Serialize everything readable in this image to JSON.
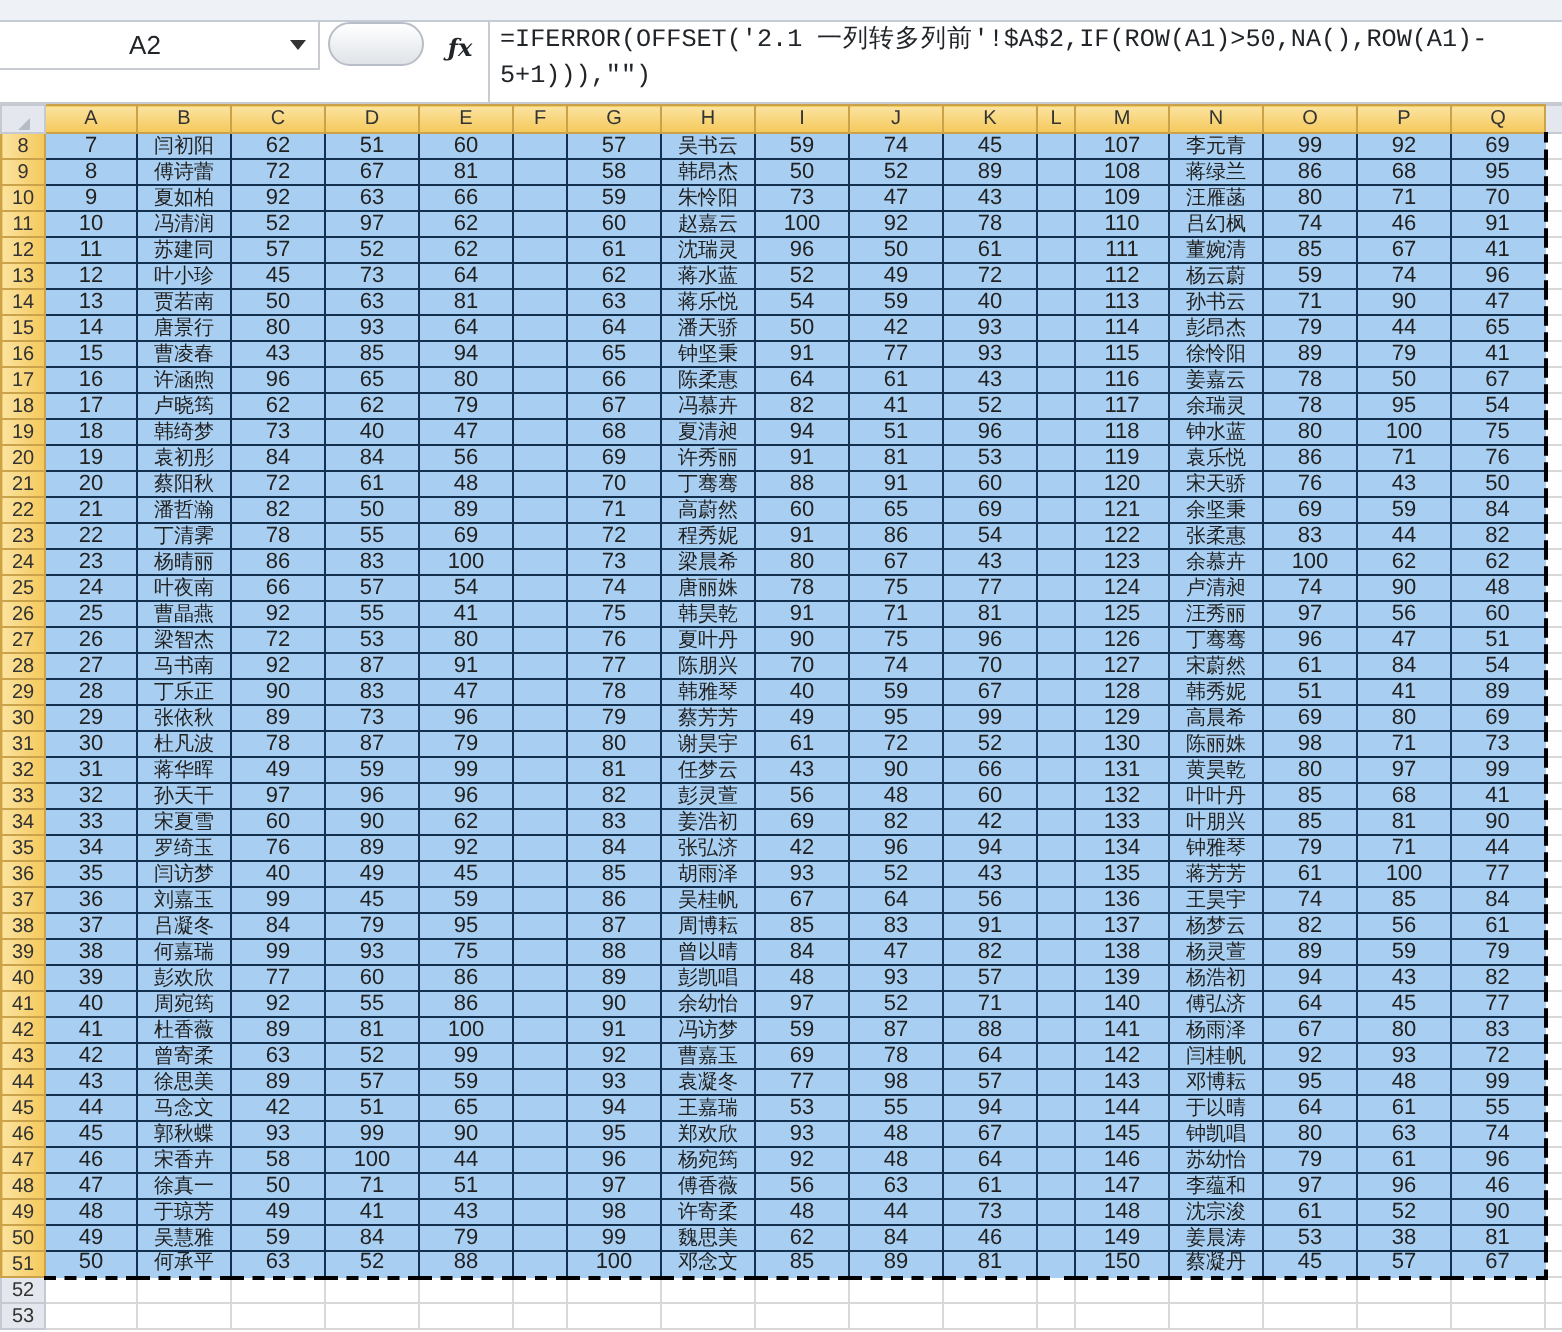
{
  "formula_bar": {
    "name_box": "A2",
    "function_symbol": "ƒx",
    "formula_lines": [
      "=IFERROR(OFFSET('2.1 一列转多列前'!$A$2,IF(ROW(A1)>50,NA(),ROW(A1)-",
      "5+1))),\"\")"
    ]
  },
  "columns": [
    {
      "letter": "A",
      "kind": "data",
      "selected": true
    },
    {
      "letter": "B",
      "kind": "data",
      "selected": true
    },
    {
      "letter": "C",
      "kind": "data",
      "selected": true
    },
    {
      "letter": "D",
      "kind": "data",
      "selected": true
    },
    {
      "letter": "E",
      "kind": "data",
      "selected": true
    },
    {
      "letter": "F",
      "kind": "spacer",
      "selected": true
    },
    {
      "letter": "G",
      "kind": "data",
      "selected": true
    },
    {
      "letter": "H",
      "kind": "data",
      "selected": true
    },
    {
      "letter": "I",
      "kind": "data",
      "selected": true
    },
    {
      "letter": "J",
      "kind": "data",
      "selected": true
    },
    {
      "letter": "K",
      "kind": "data",
      "selected": true
    },
    {
      "letter": "L",
      "kind": "spacer",
      "selected": true
    },
    {
      "letter": "M",
      "kind": "data",
      "selected": true
    },
    {
      "letter": "N",
      "kind": "data",
      "selected": true
    },
    {
      "letter": "O",
      "kind": "data",
      "selected": true
    },
    {
      "letter": "P",
      "kind": "data",
      "selected": true
    },
    {
      "letter": "Q",
      "kind": "data",
      "selected": true
    }
  ],
  "rows": [
    {
      "number": "8",
      "selected": true,
      "cells": [
        "7",
        "闫初阳",
        "62",
        "51",
        "60",
        "57",
        "吴书云",
        "59",
        "74",
        "45",
        "107",
        "李元青",
        "99",
        "92",
        "69"
      ]
    },
    {
      "number": "9",
      "selected": true,
      "cells": [
        "8",
        "傅诗蕾",
        "72",
        "67",
        "81",
        "58",
        "韩昂杰",
        "50",
        "52",
        "89",
        "108",
        "蒋绿兰",
        "86",
        "68",
        "95"
      ]
    },
    {
      "number": "10",
      "selected": true,
      "cells": [
        "9",
        "夏如柏",
        "92",
        "63",
        "66",
        "59",
        "朱怜阳",
        "73",
        "47",
        "43",
        "109",
        "汪雁菡",
        "80",
        "71",
        "70"
      ]
    },
    {
      "number": "11",
      "selected": true,
      "cells": [
        "10",
        "冯清润",
        "52",
        "97",
        "62",
        "60",
        "赵嘉云",
        "100",
        "92",
        "78",
        "110",
        "吕幻枫",
        "74",
        "46",
        "91"
      ]
    },
    {
      "number": "12",
      "selected": true,
      "cells": [
        "11",
        "苏建同",
        "57",
        "52",
        "62",
        "61",
        "沈瑞灵",
        "96",
        "50",
        "61",
        "111",
        "董婉清",
        "85",
        "67",
        "41"
      ]
    },
    {
      "number": "13",
      "selected": true,
      "cells": [
        "12",
        "叶小珍",
        "45",
        "73",
        "64",
        "62",
        "蒋水蓝",
        "52",
        "49",
        "72",
        "112",
        "杨云蔚",
        "59",
        "74",
        "96"
      ]
    },
    {
      "number": "14",
      "selected": true,
      "cells": [
        "13",
        "贾若南",
        "50",
        "63",
        "81",
        "63",
        "蒋乐悦",
        "54",
        "59",
        "40",
        "113",
        "孙书云",
        "71",
        "90",
        "47"
      ]
    },
    {
      "number": "15",
      "selected": true,
      "cells": [
        "14",
        "唐景行",
        "80",
        "93",
        "64",
        "64",
        "潘天骄",
        "50",
        "42",
        "93",
        "114",
        "彭昂杰",
        "79",
        "44",
        "65"
      ]
    },
    {
      "number": "16",
      "selected": true,
      "cells": [
        "15",
        "曹凌春",
        "43",
        "85",
        "94",
        "65",
        "钟坚秉",
        "91",
        "77",
        "93",
        "115",
        "徐怜阳",
        "89",
        "79",
        "41"
      ]
    },
    {
      "number": "17",
      "selected": true,
      "cells": [
        "16",
        "许涵煦",
        "96",
        "65",
        "80",
        "66",
        "陈柔惠",
        "64",
        "61",
        "43",
        "116",
        "姜嘉云",
        "78",
        "50",
        "67"
      ]
    },
    {
      "number": "18",
      "selected": true,
      "cells": [
        "17",
        "卢晓筠",
        "62",
        "62",
        "79",
        "67",
        "冯慕卉",
        "82",
        "41",
        "52",
        "117",
        "余瑞灵",
        "78",
        "95",
        "54"
      ]
    },
    {
      "number": "19",
      "selected": true,
      "cells": [
        "18",
        "韩绮梦",
        "73",
        "40",
        "47",
        "68",
        "夏清昶",
        "94",
        "51",
        "96",
        "118",
        "钟水蓝",
        "80",
        "100",
        "75"
      ]
    },
    {
      "number": "20",
      "selected": true,
      "cells": [
        "19",
        "袁初彤",
        "84",
        "84",
        "56",
        "69",
        "许秀丽",
        "91",
        "81",
        "53",
        "119",
        "袁乐悦",
        "86",
        "71",
        "76"
      ]
    },
    {
      "number": "21",
      "selected": true,
      "cells": [
        "20",
        "蔡阳秋",
        "72",
        "61",
        "48",
        "70",
        "丁骞骞",
        "88",
        "91",
        "60",
        "120",
        "宋天骄",
        "76",
        "43",
        "50"
      ]
    },
    {
      "number": "22",
      "selected": true,
      "cells": [
        "21",
        "潘哲瀚",
        "82",
        "50",
        "89",
        "71",
        "高蔚然",
        "60",
        "65",
        "69",
        "121",
        "余坚秉",
        "69",
        "59",
        "84"
      ]
    },
    {
      "number": "23",
      "selected": true,
      "cells": [
        "22",
        "丁清霁",
        "78",
        "55",
        "69",
        "72",
        "程秀妮",
        "91",
        "86",
        "54",
        "122",
        "张柔惠",
        "83",
        "44",
        "82"
      ]
    },
    {
      "number": "24",
      "selected": true,
      "cells": [
        "23",
        "杨晴丽",
        "86",
        "83",
        "100",
        "73",
        "梁晨希",
        "80",
        "67",
        "43",
        "123",
        "余慕卉",
        "100",
        "62",
        "62"
      ]
    },
    {
      "number": "25",
      "selected": true,
      "cells": [
        "24",
        "叶夜南",
        "66",
        "57",
        "54",
        "74",
        "唐丽姝",
        "78",
        "75",
        "77",
        "124",
        "卢清昶",
        "74",
        "90",
        "48"
      ]
    },
    {
      "number": "26",
      "selected": true,
      "cells": [
        "25",
        "曹晶燕",
        "92",
        "55",
        "41",
        "75",
        "韩昊乾",
        "91",
        "71",
        "81",
        "125",
        "汪秀丽",
        "97",
        "56",
        "60"
      ]
    },
    {
      "number": "27",
      "selected": true,
      "cells": [
        "26",
        "梁智杰",
        "72",
        "53",
        "80",
        "76",
        "夏叶丹",
        "90",
        "75",
        "96",
        "126",
        "丁骞骞",
        "96",
        "47",
        "51"
      ]
    },
    {
      "number": "28",
      "selected": true,
      "cells": [
        "27",
        "马书南",
        "92",
        "87",
        "91",
        "77",
        "陈朋兴",
        "70",
        "74",
        "70",
        "127",
        "宋蔚然",
        "61",
        "84",
        "54"
      ]
    },
    {
      "number": "29",
      "selected": true,
      "cells": [
        "28",
        "丁乐正",
        "90",
        "83",
        "47",
        "78",
        "韩雅琴",
        "40",
        "59",
        "67",
        "128",
        "韩秀妮",
        "51",
        "41",
        "89"
      ]
    },
    {
      "number": "30",
      "selected": true,
      "cells": [
        "29",
        "张依秋",
        "89",
        "73",
        "96",
        "79",
        "蔡芳芳",
        "49",
        "95",
        "99",
        "129",
        "高晨希",
        "69",
        "80",
        "69"
      ]
    },
    {
      "number": "31",
      "selected": true,
      "cells": [
        "30",
        "杜凡波",
        "78",
        "87",
        "79",
        "80",
        "谢昊宇",
        "61",
        "72",
        "52",
        "130",
        "陈丽姝",
        "98",
        "71",
        "73"
      ]
    },
    {
      "number": "32",
      "selected": true,
      "cells": [
        "31",
        "蒋华晖",
        "49",
        "59",
        "99",
        "81",
        "任梦云",
        "43",
        "90",
        "66",
        "131",
        "黄昊乾",
        "80",
        "97",
        "99"
      ]
    },
    {
      "number": "33",
      "selected": true,
      "cells": [
        "32",
        "孙天干",
        "97",
        "96",
        "96",
        "82",
        "彭灵萱",
        "56",
        "48",
        "60",
        "132",
        "叶叶丹",
        "85",
        "68",
        "41"
      ]
    },
    {
      "number": "34",
      "selected": true,
      "cells": [
        "33",
        "宋夏雪",
        "60",
        "90",
        "62",
        "83",
        "姜浩初",
        "69",
        "82",
        "42",
        "133",
        "叶朋兴",
        "85",
        "81",
        "90"
      ]
    },
    {
      "number": "35",
      "selected": true,
      "cells": [
        "34",
        "罗绮玉",
        "76",
        "89",
        "92",
        "84",
        "张弘济",
        "42",
        "96",
        "94",
        "134",
        "钟雅琴",
        "79",
        "71",
        "44"
      ]
    },
    {
      "number": "36",
      "selected": true,
      "cells": [
        "35",
        "闫访梦",
        "40",
        "49",
        "45",
        "85",
        "胡雨泽",
        "93",
        "52",
        "43",
        "135",
        "蒋芳芳",
        "61",
        "100",
        "77"
      ]
    },
    {
      "number": "37",
      "selected": true,
      "cells": [
        "36",
        "刘嘉玉",
        "99",
        "45",
        "59",
        "86",
        "吴桂帆",
        "67",
        "64",
        "56",
        "136",
        "王昊宇",
        "74",
        "85",
        "84"
      ]
    },
    {
      "number": "38",
      "selected": true,
      "cells": [
        "37",
        "吕凝冬",
        "84",
        "79",
        "95",
        "87",
        "周博耘",
        "85",
        "83",
        "91",
        "137",
        "杨梦云",
        "82",
        "56",
        "61"
      ]
    },
    {
      "number": "39",
      "selected": true,
      "cells": [
        "38",
        "何嘉瑞",
        "99",
        "93",
        "75",
        "88",
        "曾以晴",
        "84",
        "47",
        "82",
        "138",
        "杨灵萱",
        "89",
        "59",
        "79"
      ]
    },
    {
      "number": "40",
      "selected": true,
      "cells": [
        "39",
        "彭欢欣",
        "77",
        "60",
        "86",
        "89",
        "彭凯唱",
        "48",
        "93",
        "57",
        "139",
        "杨浩初",
        "94",
        "43",
        "82"
      ]
    },
    {
      "number": "41",
      "selected": true,
      "cells": [
        "40",
        "周宛筠",
        "92",
        "55",
        "86",
        "90",
        "余幼怡",
        "97",
        "52",
        "71",
        "140",
        "傅弘济",
        "64",
        "45",
        "77"
      ]
    },
    {
      "number": "42",
      "selected": true,
      "cells": [
        "41",
        "杜香薇",
        "89",
        "81",
        "100",
        "91",
        "冯访梦",
        "59",
        "87",
        "88",
        "141",
        "杨雨泽",
        "67",
        "80",
        "83"
      ]
    },
    {
      "number": "43",
      "selected": true,
      "cells": [
        "42",
        "曾寄柔",
        "63",
        "52",
        "99",
        "92",
        "曹嘉玉",
        "69",
        "78",
        "64",
        "142",
        "闫桂帆",
        "92",
        "93",
        "72"
      ]
    },
    {
      "number": "44",
      "selected": true,
      "cells": [
        "43",
        "徐思美",
        "89",
        "57",
        "59",
        "93",
        "袁凝冬",
        "77",
        "98",
        "57",
        "143",
        "邓博耘",
        "95",
        "48",
        "99"
      ]
    },
    {
      "number": "45",
      "selected": true,
      "cells": [
        "44",
        "马念文",
        "42",
        "51",
        "65",
        "94",
        "王嘉瑞",
        "53",
        "55",
        "94",
        "144",
        "于以晴",
        "64",
        "61",
        "55"
      ]
    },
    {
      "number": "46",
      "selected": true,
      "cells": [
        "45",
        "郭秋蝶",
        "93",
        "99",
        "90",
        "95",
        "郑欢欣",
        "93",
        "48",
        "67",
        "145",
        "钟凯唱",
        "80",
        "63",
        "74"
      ]
    },
    {
      "number": "47",
      "selected": true,
      "cells": [
        "46",
        "宋香卉",
        "58",
        "100",
        "44",
        "96",
        "杨宛筠",
        "92",
        "48",
        "64",
        "146",
        "苏幼怡",
        "79",
        "61",
        "96"
      ]
    },
    {
      "number": "48",
      "selected": true,
      "cells": [
        "47",
        "徐真一",
        "50",
        "71",
        "51",
        "97",
        "傅香薇",
        "56",
        "63",
        "61",
        "147",
        "李蕴和",
        "97",
        "96",
        "46"
      ]
    },
    {
      "number": "49",
      "selected": true,
      "cells": [
        "48",
        "于琼芳",
        "49",
        "41",
        "43",
        "98",
        "许寄柔",
        "48",
        "44",
        "73",
        "148",
        "沈宗浚",
        "61",
        "52",
        "90"
      ]
    },
    {
      "number": "50",
      "selected": true,
      "cells": [
        "49",
        "吴慧雅",
        "59",
        "84",
        "79",
        "99",
        "魏思美",
        "62",
        "84",
        "46",
        "149",
        "姜晨涛",
        "53",
        "38",
        "81"
      ]
    },
    {
      "number": "51",
      "selected": true,
      "cells": [
        "50",
        "何承平",
        "63",
        "52",
        "88",
        "100",
        "邓念文",
        "85",
        "89",
        "81",
        "150",
        "蔡凝丹",
        "45",
        "57",
        "67"
      ]
    },
    {
      "number": "52",
      "selected": false
    },
    {
      "number": "53",
      "selected": false
    }
  ]
}
